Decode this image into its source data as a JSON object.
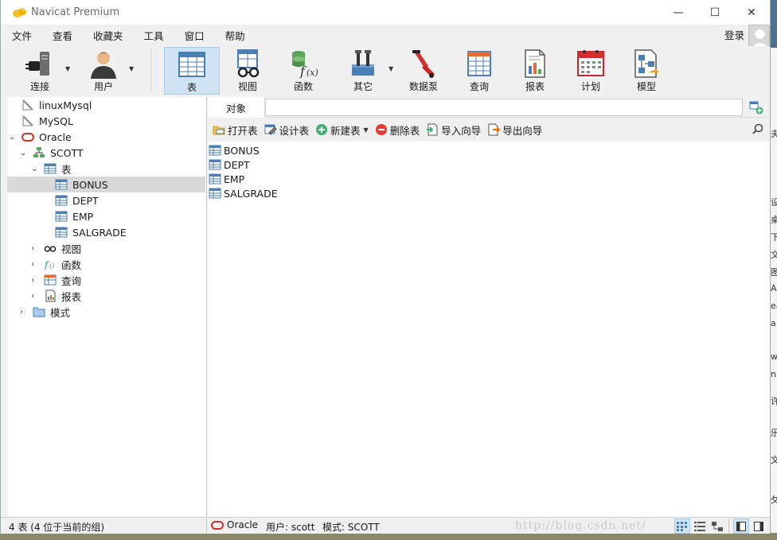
{
  "window": {
    "title": "Navicat Premium",
    "controls": {
      "minimize": "—",
      "maximize": "☐",
      "close": "✕"
    }
  },
  "menubar": {
    "items": [
      "文件",
      "查看",
      "收藏夹",
      "工具",
      "窗口",
      "帮助"
    ],
    "login": "登录"
  },
  "toolbar": {
    "buttons": [
      {
        "label": "连接",
        "icon": "connection-plug-icon",
        "dropdown": true
      },
      {
        "label": "用户",
        "icon": "user-icon",
        "dropdown": true
      },
      {
        "label": "表",
        "icon": "table-icon",
        "active": true
      },
      {
        "label": "视图",
        "icon": "view-glasses-icon"
      },
      {
        "label": "函数",
        "icon": "function-icon"
      },
      {
        "label": "其它",
        "icon": "tools-icon",
        "dropdown": true
      },
      {
        "label": "数据泵",
        "icon": "data-pump-icon"
      },
      {
        "label": "查询",
        "icon": "query-icon"
      },
      {
        "label": "报表",
        "icon": "report-icon"
      },
      {
        "label": "计划",
        "icon": "calendar-icon"
      },
      {
        "label": "模型",
        "icon": "model-icon"
      }
    ]
  },
  "sidebar": {
    "tree": [
      {
        "label": "linuxMysql",
        "icon": "mysql-connection-icon",
        "level": 0
      },
      {
        "label": "MySQL",
        "icon": "mysql-connection-icon",
        "level": 0
      },
      {
        "label": "Oracle",
        "icon": "oracle-connection-icon",
        "level": 0,
        "expanded": true
      },
      {
        "label": "SCOTT",
        "icon": "schema-icon",
        "level": 1,
        "expanded": true
      },
      {
        "label": "表",
        "icon": "table-folder-icon",
        "level": 2,
        "expanded": true
      },
      {
        "label": "BONUS",
        "icon": "table-icon",
        "level": 3,
        "selected": true
      },
      {
        "label": "DEPT",
        "icon": "table-icon",
        "level": 3
      },
      {
        "label": "EMP",
        "icon": "table-icon",
        "level": 3
      },
      {
        "label": "SALGRADE",
        "icon": "table-icon",
        "level": 3
      },
      {
        "label": "视图",
        "icon": "view-glasses-icon",
        "level": 2,
        "collapsed": true
      },
      {
        "label": "函数",
        "icon": "function-icon",
        "level": 2,
        "collapsed": true
      },
      {
        "label": "查询",
        "icon": "query-icon",
        "level": 2,
        "collapsed": true
      },
      {
        "label": "报表",
        "icon": "report-icon",
        "level": 2,
        "collapsed": true
      },
      {
        "label": "模式",
        "icon": "folder-icon",
        "level": 1,
        "collapsed": true
      }
    ]
  },
  "main": {
    "tab": "对象",
    "object_toolbar": {
      "open_table": "打开表",
      "design_table": "设计表",
      "new_table": "新建表",
      "delete_table": "删除表",
      "import_wizard": "导入向导",
      "export_wizard": "导出向导"
    },
    "objects": [
      "BONUS",
      "DEPT",
      "EMP",
      "SALGRADE"
    ]
  },
  "statusbar": {
    "summary": "4 表 (4 位于当前的组)",
    "connection": "Oracle",
    "user": "用户: scott",
    "schema": "模式: SCOTT",
    "watermark": "http://blog.csdn.net/"
  },
  "right_peek": [
    "夬",
    "设",
    "桌",
    "下",
    "文",
    "图",
    "A",
    "ea",
    "a",
    "w",
    "n",
    "许",
    "乐",
    "文",
    "攵"
  ],
  "colors": {
    "active_button_bg": "#cfe3f4",
    "selection_bg": "#d9d9d9",
    "oracle_red": "#c0392b",
    "table_blue": "#4a7fb5"
  }
}
